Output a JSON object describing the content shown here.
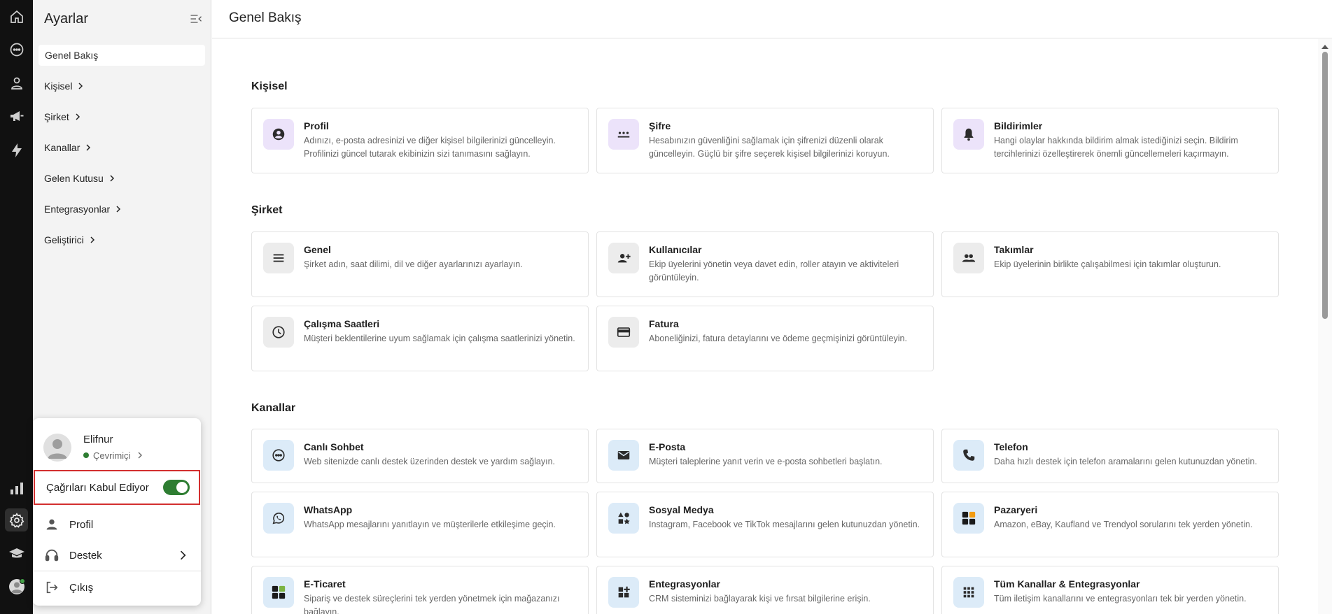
{
  "sidebar": {
    "title": "Ayarlar",
    "active_item": "Genel Bakış",
    "items": [
      {
        "label": "Kişisel"
      },
      {
        "label": "Şirket"
      },
      {
        "label": "Kanallar"
      },
      {
        "label": "Gelen Kutusu"
      },
      {
        "label": "Entegrasyonlar"
      },
      {
        "label": "Geliştirici"
      }
    ]
  },
  "header": {
    "title": "Genel Bakış"
  },
  "sections": {
    "personal": {
      "title": "Kişisel",
      "cards": [
        {
          "title": "Profil",
          "desc": "Adınızı, e-posta adresinizi ve diğer kişisel bilgilerinizi güncelleyin. Profilinizi güncel tutarak ekibinizin sizi tanımasını sağlayın.",
          "icon": "account-circle-icon"
        },
        {
          "title": "Şifre",
          "desc": "Hesabınızın güvenliğini sağlamak için şifrenizi düzenli olarak güncelleyin. Güçlü bir şifre seçerek kişisel bilgilerinizi koruyun.",
          "icon": "password-icon"
        },
        {
          "title": "Bildirimler",
          "desc": "Hangi olaylar hakkında bildirim almak istediğinizi seçin. Bildirim tercihlerinizi özelleştirerek önemli güncellemeleri kaçırmayın.",
          "icon": "bell-icon"
        }
      ]
    },
    "company": {
      "title": "Şirket",
      "cards": [
        {
          "title": "Genel",
          "desc": "Şirket adın, saat dilimi, dil ve diğer ayarlarınızı ayarlayın.",
          "icon": "menu-lines-icon"
        },
        {
          "title": "Kullanıcılar",
          "desc": "Ekip üyelerini yönetin veya davet edin, roller atayın ve aktiviteleri görüntüleyin.",
          "icon": "person-add-icon"
        },
        {
          "title": "Takımlar",
          "desc": "Ekip üyelerinin birlikte çalışabilmesi için takımlar oluşturun.",
          "icon": "group-icon"
        },
        {
          "title": "Çalışma Saatleri",
          "desc": "Müşteri beklentilerine uyum sağlamak için çalışma saatlerinizi yönetin.",
          "icon": "clock-icon"
        },
        {
          "title": "Fatura",
          "desc": "Aboneliğinizi, fatura detaylarını ve ödeme geçmişinizi görüntüleyin.",
          "icon": "credit-card-icon"
        }
      ]
    },
    "channels": {
      "title": "Kanallar",
      "cards": [
        {
          "title": "Canlı Sohbet",
          "desc": "Web sitenizde canlı destek üzerinden destek ve yardım sağlayın.",
          "icon": "chat-bubble-icon"
        },
        {
          "title": "E-Posta",
          "desc": "Müşteri taleplerine yanıt verin ve e-posta sohbetleri başlatın.",
          "icon": "mail-icon"
        },
        {
          "title": "Telefon",
          "desc": "Daha hızlı destek için telefon aramalarını gelen kutunuzdan yönetin.",
          "icon": "phone-icon"
        },
        {
          "title": "WhatsApp",
          "desc": "WhatsApp mesajlarını yanıtlayın ve müşterilerle etkileşime geçin.",
          "icon": "whatsapp-icon"
        },
        {
          "title": "Sosyal Medya",
          "desc": "Instagram, Facebook ve TikTok mesajlarını gelen kutunuzdan yönetin.",
          "icon": "social-shapes-icon"
        },
        {
          "title": "Pazaryeri",
          "desc": "Amazon, eBay, Kaufland ve Trendyol sorularını tek yerden yönetin.",
          "icon": "marketplace-icon"
        },
        {
          "title": "E-Ticaret",
          "desc": "Sipariş ve destek süreçlerini tek yerden yönetmek için mağazanızı bağlayın.",
          "icon": "ecommerce-icon"
        },
        {
          "title": "Entegrasyonlar",
          "desc": "CRM sisteminizi bağlayarak kişi ve fırsat bilgilerine erişin.",
          "icon": "widgets-icon"
        },
        {
          "title": "Tüm Kanallar & Entegrasyonlar",
          "desc": "Tüm iletişim kanallarını ve entegrasyonları tek bir yerden yönetin.",
          "icon": "apps-grid-icon"
        }
      ]
    }
  },
  "popup": {
    "user_name": "Elifnur",
    "status": "Çevrimiçi",
    "calls_label": "Çağrıları Kabul Ediyor",
    "calls_enabled": true,
    "profile_label": "Profil",
    "support_label": "Destek",
    "logout_label": "Çıkış"
  },
  "colors": {
    "rail_bg": "#111111",
    "sidebar_bg": "#f3f3f3",
    "toggle_on": "#2e7d32",
    "highlight_border": "#d32f2f"
  }
}
